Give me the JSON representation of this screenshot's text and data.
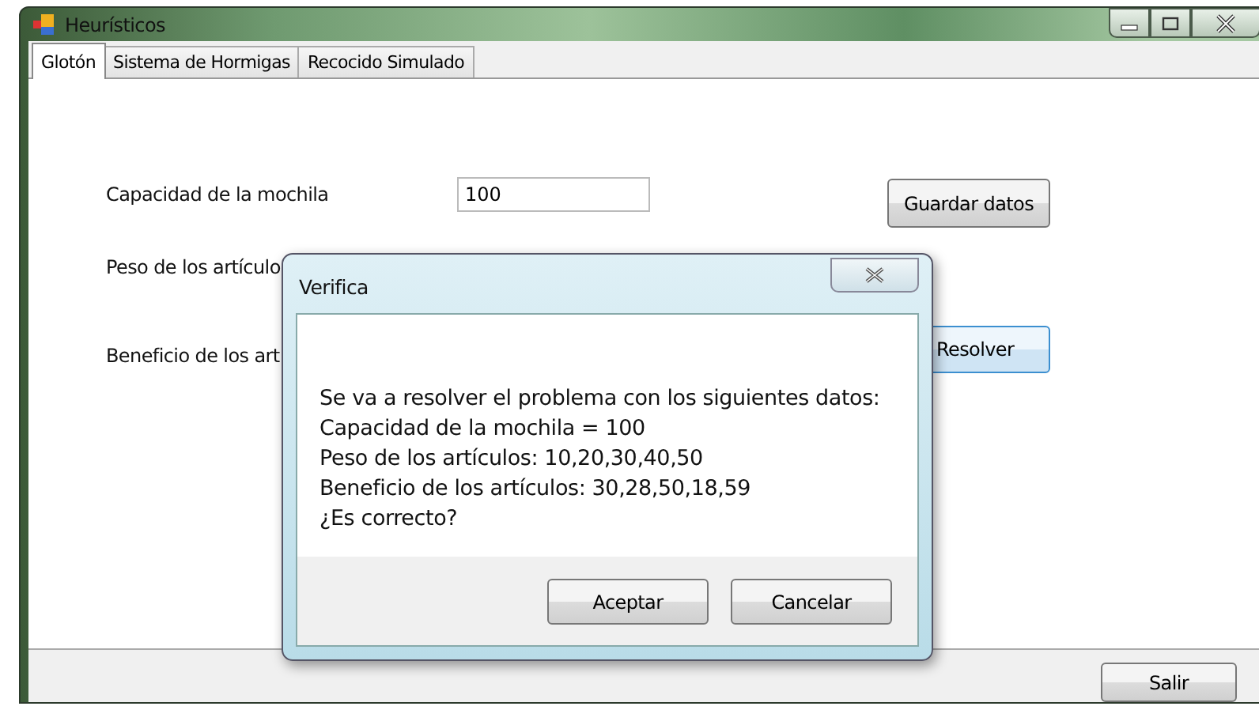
{
  "window": {
    "title": "Heurísticos"
  },
  "tabs": [
    {
      "label": "Glotón",
      "selected": true
    },
    {
      "label": "Sistema de Hormigas",
      "selected": false
    },
    {
      "label": "Recocido Simulado",
      "selected": false
    }
  ],
  "form": {
    "capacity_label": "Capacidad de la mochila",
    "capacity_value": "100",
    "save_button": "Guardar datos",
    "weights_label": "Peso de los artículo",
    "benefits_label": "Beneficio de los art",
    "solve_button": "Resolver"
  },
  "exit_button": "Salir",
  "dialog": {
    "title": "Verifica",
    "lines": [
      "Se va a resolver el problema con los siguientes datos:",
      "Capacidad de la mochila = 100",
      "Peso de los artículos: 10,20,30,40,50",
      "Beneficio de los artículos: 30,28,50,18,59",
      "¿Es correcto?"
    ],
    "buttons": [
      "Aceptar",
      "Cancelar"
    ]
  }
}
